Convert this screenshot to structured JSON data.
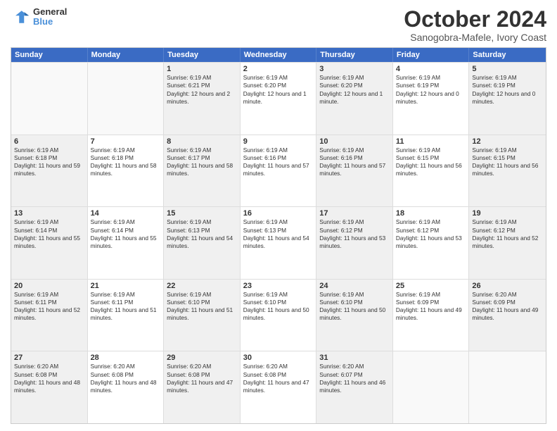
{
  "header": {
    "logo_general": "General",
    "logo_blue": "Blue",
    "month_title": "October 2024",
    "subtitle": "Sanogobra-Mafele, Ivory Coast"
  },
  "weekdays": [
    "Sunday",
    "Monday",
    "Tuesday",
    "Wednesday",
    "Thursday",
    "Friday",
    "Saturday"
  ],
  "weeks": [
    [
      {
        "day": "",
        "sunrise": "",
        "sunset": "",
        "daylight": "",
        "empty": true
      },
      {
        "day": "",
        "sunrise": "",
        "sunset": "",
        "daylight": "",
        "empty": true
      },
      {
        "day": "1",
        "sunrise": "Sunrise: 6:19 AM",
        "sunset": "Sunset: 6:21 PM",
        "daylight": "Daylight: 12 hours and 2 minutes.",
        "empty": false
      },
      {
        "day": "2",
        "sunrise": "Sunrise: 6:19 AM",
        "sunset": "Sunset: 6:20 PM",
        "daylight": "Daylight: 12 hours and 1 minute.",
        "empty": false
      },
      {
        "day": "3",
        "sunrise": "Sunrise: 6:19 AM",
        "sunset": "Sunset: 6:20 PM",
        "daylight": "Daylight: 12 hours and 1 minute.",
        "empty": false
      },
      {
        "day": "4",
        "sunrise": "Sunrise: 6:19 AM",
        "sunset": "Sunset: 6:19 PM",
        "daylight": "Daylight: 12 hours and 0 minutes.",
        "empty": false
      },
      {
        "day": "5",
        "sunrise": "Sunrise: 6:19 AM",
        "sunset": "Sunset: 6:19 PM",
        "daylight": "Daylight: 12 hours and 0 minutes.",
        "empty": false
      }
    ],
    [
      {
        "day": "6",
        "sunrise": "Sunrise: 6:19 AM",
        "sunset": "Sunset: 6:18 PM",
        "daylight": "Daylight: 11 hours and 59 minutes.",
        "empty": false
      },
      {
        "day": "7",
        "sunrise": "Sunrise: 6:19 AM",
        "sunset": "Sunset: 6:18 PM",
        "daylight": "Daylight: 11 hours and 58 minutes.",
        "empty": false
      },
      {
        "day": "8",
        "sunrise": "Sunrise: 6:19 AM",
        "sunset": "Sunset: 6:17 PM",
        "daylight": "Daylight: 11 hours and 58 minutes.",
        "empty": false
      },
      {
        "day": "9",
        "sunrise": "Sunrise: 6:19 AM",
        "sunset": "Sunset: 6:16 PM",
        "daylight": "Daylight: 11 hours and 57 minutes.",
        "empty": false
      },
      {
        "day": "10",
        "sunrise": "Sunrise: 6:19 AM",
        "sunset": "Sunset: 6:16 PM",
        "daylight": "Daylight: 11 hours and 57 minutes.",
        "empty": false
      },
      {
        "day": "11",
        "sunrise": "Sunrise: 6:19 AM",
        "sunset": "Sunset: 6:15 PM",
        "daylight": "Daylight: 11 hours and 56 minutes.",
        "empty": false
      },
      {
        "day": "12",
        "sunrise": "Sunrise: 6:19 AM",
        "sunset": "Sunset: 6:15 PM",
        "daylight": "Daylight: 11 hours and 56 minutes.",
        "empty": false
      }
    ],
    [
      {
        "day": "13",
        "sunrise": "Sunrise: 6:19 AM",
        "sunset": "Sunset: 6:14 PM",
        "daylight": "Daylight: 11 hours and 55 minutes.",
        "empty": false
      },
      {
        "day": "14",
        "sunrise": "Sunrise: 6:19 AM",
        "sunset": "Sunset: 6:14 PM",
        "daylight": "Daylight: 11 hours and 55 minutes.",
        "empty": false
      },
      {
        "day": "15",
        "sunrise": "Sunrise: 6:19 AM",
        "sunset": "Sunset: 6:13 PM",
        "daylight": "Daylight: 11 hours and 54 minutes.",
        "empty": false
      },
      {
        "day": "16",
        "sunrise": "Sunrise: 6:19 AM",
        "sunset": "Sunset: 6:13 PM",
        "daylight": "Daylight: 11 hours and 54 minutes.",
        "empty": false
      },
      {
        "day": "17",
        "sunrise": "Sunrise: 6:19 AM",
        "sunset": "Sunset: 6:12 PM",
        "daylight": "Daylight: 11 hours and 53 minutes.",
        "empty": false
      },
      {
        "day": "18",
        "sunrise": "Sunrise: 6:19 AM",
        "sunset": "Sunset: 6:12 PM",
        "daylight": "Daylight: 11 hours and 53 minutes.",
        "empty": false
      },
      {
        "day": "19",
        "sunrise": "Sunrise: 6:19 AM",
        "sunset": "Sunset: 6:12 PM",
        "daylight": "Daylight: 11 hours and 52 minutes.",
        "empty": false
      }
    ],
    [
      {
        "day": "20",
        "sunrise": "Sunrise: 6:19 AM",
        "sunset": "Sunset: 6:11 PM",
        "daylight": "Daylight: 11 hours and 52 minutes.",
        "empty": false
      },
      {
        "day": "21",
        "sunrise": "Sunrise: 6:19 AM",
        "sunset": "Sunset: 6:11 PM",
        "daylight": "Daylight: 11 hours and 51 minutes.",
        "empty": false
      },
      {
        "day": "22",
        "sunrise": "Sunrise: 6:19 AM",
        "sunset": "Sunset: 6:10 PM",
        "daylight": "Daylight: 11 hours and 51 minutes.",
        "empty": false
      },
      {
        "day": "23",
        "sunrise": "Sunrise: 6:19 AM",
        "sunset": "Sunset: 6:10 PM",
        "daylight": "Daylight: 11 hours and 50 minutes.",
        "empty": false
      },
      {
        "day": "24",
        "sunrise": "Sunrise: 6:19 AM",
        "sunset": "Sunset: 6:10 PM",
        "daylight": "Daylight: 11 hours and 50 minutes.",
        "empty": false
      },
      {
        "day": "25",
        "sunrise": "Sunrise: 6:19 AM",
        "sunset": "Sunset: 6:09 PM",
        "daylight": "Daylight: 11 hours and 49 minutes.",
        "empty": false
      },
      {
        "day": "26",
        "sunrise": "Sunrise: 6:20 AM",
        "sunset": "Sunset: 6:09 PM",
        "daylight": "Daylight: 11 hours and 49 minutes.",
        "empty": false
      }
    ],
    [
      {
        "day": "27",
        "sunrise": "Sunrise: 6:20 AM",
        "sunset": "Sunset: 6:08 PM",
        "daylight": "Daylight: 11 hours and 48 minutes.",
        "empty": false
      },
      {
        "day": "28",
        "sunrise": "Sunrise: 6:20 AM",
        "sunset": "Sunset: 6:08 PM",
        "daylight": "Daylight: 11 hours and 48 minutes.",
        "empty": false
      },
      {
        "day": "29",
        "sunrise": "Sunrise: 6:20 AM",
        "sunset": "Sunset: 6:08 PM",
        "daylight": "Daylight: 11 hours and 47 minutes.",
        "empty": false
      },
      {
        "day": "30",
        "sunrise": "Sunrise: 6:20 AM",
        "sunset": "Sunset: 6:08 PM",
        "daylight": "Daylight: 11 hours and 47 minutes.",
        "empty": false
      },
      {
        "day": "31",
        "sunrise": "Sunrise: 6:20 AM",
        "sunset": "Sunset: 6:07 PM",
        "daylight": "Daylight: 11 hours and 46 minutes.",
        "empty": false
      },
      {
        "day": "",
        "sunrise": "",
        "sunset": "",
        "daylight": "",
        "empty": true
      },
      {
        "day": "",
        "sunrise": "",
        "sunset": "",
        "daylight": "",
        "empty": true
      }
    ]
  ]
}
